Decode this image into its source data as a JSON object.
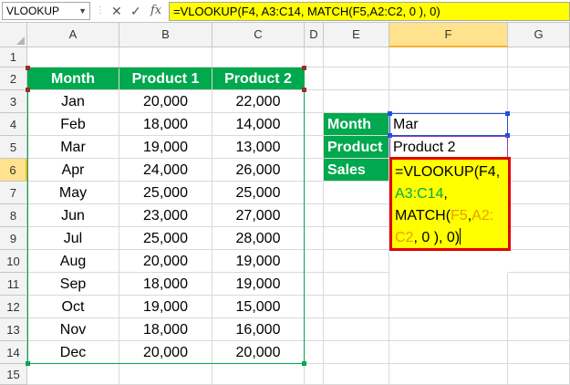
{
  "name_box": {
    "value": "VLOOKUP"
  },
  "formula_bar": {
    "cancel_glyph": "✕",
    "enter_glyph": "✓",
    "fx_label": "fx",
    "formula": "=VLOOKUP(F4, A3:C14, MATCH(F5,A2:C2, 0 ), 0)"
  },
  "columns": [
    "A",
    "B",
    "C",
    "D",
    "E",
    "F",
    "G"
  ],
  "rows": [
    "1",
    "2",
    "3",
    "4",
    "5",
    "6",
    "7",
    "8",
    "9",
    "10",
    "11",
    "12",
    "13",
    "14",
    "15"
  ],
  "table": {
    "headers": [
      "Month",
      "Product 1",
      "Product 2"
    ],
    "rows": [
      [
        "Jan",
        "20,000",
        "22,000"
      ],
      [
        "Feb",
        "18,000",
        "14,000"
      ],
      [
        "Mar",
        "19,000",
        "13,000"
      ],
      [
        "Apr",
        "24,000",
        "26,000"
      ],
      [
        "May",
        "25,000",
        "25,000"
      ],
      [
        "Jun",
        "23,000",
        "27,000"
      ],
      [
        "Jul",
        "25,000",
        "28,000"
      ],
      [
        "Aug",
        "20,000",
        "19,000"
      ],
      [
        "Sep",
        "18,000",
        "19,000"
      ],
      [
        "Oct",
        "19,000",
        "15,000"
      ],
      [
        "Nov",
        "18,000",
        "16,000"
      ],
      [
        "Dec",
        "20,000",
        "20,000"
      ]
    ]
  },
  "lookup": {
    "month_label": "Month",
    "month_value": "Mar",
    "product_label": "Product",
    "product_value": "Product 2",
    "sales_label": "Sales"
  },
  "editor": {
    "p1": "=VLOOKUP(",
    "ref1": "F4",
    "p2": ",",
    "ref2": "A3:C14",
    "p3": ",",
    "p4": "MATCH(",
    "ref3": "F5",
    "p5": ",",
    "ref4": "A2:",
    "ref4b": "C2",
    "p6": ", 0 ), 0)"
  },
  "colors": {
    "header_green": "#00a84e",
    "highlight_yellow": "#ffff00",
    "edit_border_red": "#e00000"
  }
}
